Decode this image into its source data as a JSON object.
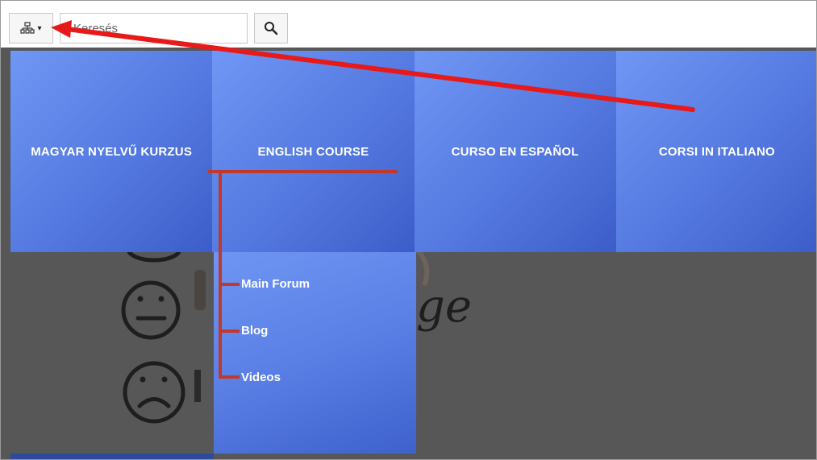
{
  "toolbar": {
    "sitemap_icon": "sitemap-icon",
    "caret": "▾",
    "search_placeholder": "Keresés",
    "search_icon": "magnifier-icon"
  },
  "nav": {
    "items": [
      {
        "label": "MAGYAR NYELVŰ KURZUS"
      },
      {
        "label": "ENGLISH COURSE"
      },
      {
        "label": "CURSO EN ESPAÑOL"
      },
      {
        "label": "CORSI IN ITALIANO"
      }
    ],
    "submenu": [
      {
        "label": "Main Forum"
      },
      {
        "label": "Blog"
      },
      {
        "label": "Videos"
      }
    ]
  },
  "background_text": "ge",
  "colors": {
    "tile": "#5479e0",
    "annotation": "#c0392b",
    "arrow": "#e81919"
  }
}
